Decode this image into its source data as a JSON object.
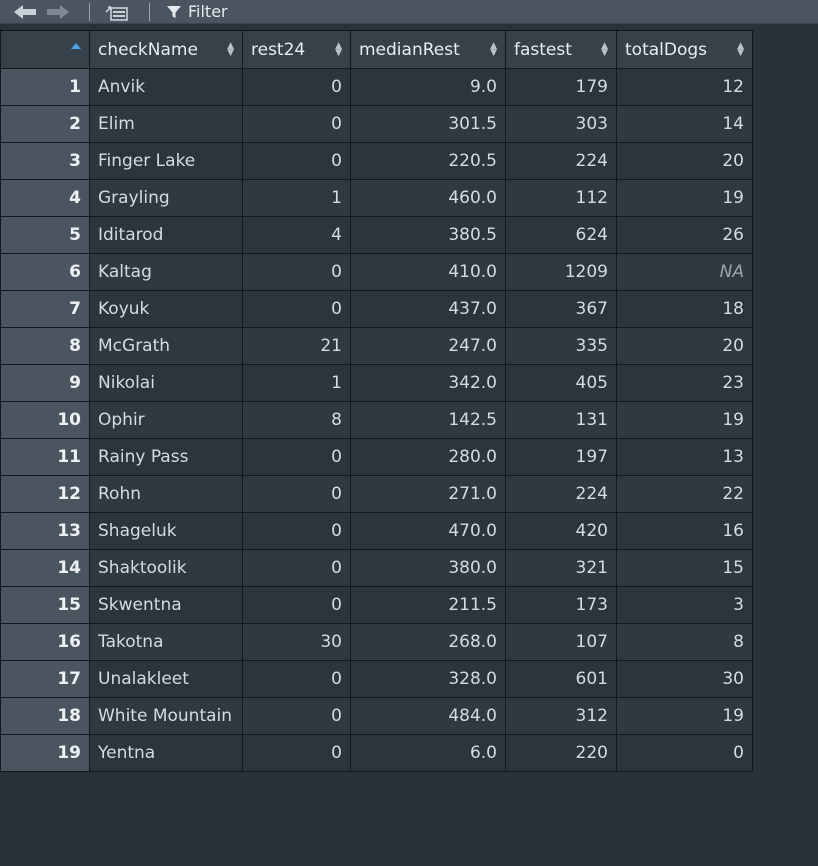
{
  "toolbar": {
    "filter_label": "Filter",
    "back_icon": "arrow-left-icon",
    "forward_icon": "arrow-right-icon",
    "popout_icon": "popout-icon",
    "filter_icon": "funnel-icon"
  },
  "table": {
    "columns": [
      "checkName",
      "rest24",
      "medianRest",
      "fastest",
      "totalDogs"
    ],
    "rows": [
      {
        "n": "1",
        "checkName": "Anvik",
        "rest24": "0",
        "medianRest": "9.0",
        "fastest": "179",
        "totalDogs": "12"
      },
      {
        "n": "2",
        "checkName": "Elim",
        "rest24": "0",
        "medianRest": "301.5",
        "fastest": "303",
        "totalDogs": "14"
      },
      {
        "n": "3",
        "checkName": "Finger Lake",
        "rest24": "0",
        "medianRest": "220.5",
        "fastest": "224",
        "totalDogs": "20"
      },
      {
        "n": "4",
        "checkName": "Grayling",
        "rest24": "1",
        "medianRest": "460.0",
        "fastest": "112",
        "totalDogs": "19"
      },
      {
        "n": "5",
        "checkName": "Iditarod",
        "rest24": "4",
        "medianRest": "380.5",
        "fastest": "624",
        "totalDogs": "26"
      },
      {
        "n": "6",
        "checkName": "Kaltag",
        "rest24": "0",
        "medianRest": "410.0",
        "fastest": "1209",
        "totalDogs": "NA"
      },
      {
        "n": "7",
        "checkName": "Koyuk",
        "rest24": "0",
        "medianRest": "437.0",
        "fastest": "367",
        "totalDogs": "18"
      },
      {
        "n": "8",
        "checkName": "McGrath",
        "rest24": "21",
        "medianRest": "247.0",
        "fastest": "335",
        "totalDogs": "20"
      },
      {
        "n": "9",
        "checkName": "Nikolai",
        "rest24": "1",
        "medianRest": "342.0",
        "fastest": "405",
        "totalDogs": "23"
      },
      {
        "n": "10",
        "checkName": "Ophir",
        "rest24": "8",
        "medianRest": "142.5",
        "fastest": "131",
        "totalDogs": "19"
      },
      {
        "n": "11",
        "checkName": "Rainy Pass",
        "rest24": "0",
        "medianRest": "280.0",
        "fastest": "197",
        "totalDogs": "13"
      },
      {
        "n": "12",
        "checkName": "Rohn",
        "rest24": "0",
        "medianRest": "271.0",
        "fastest": "224",
        "totalDogs": "22"
      },
      {
        "n": "13",
        "checkName": "Shageluk",
        "rest24": "0",
        "medianRest": "470.0",
        "fastest": "420",
        "totalDogs": "16"
      },
      {
        "n": "14",
        "checkName": "Shaktoolik",
        "rest24": "0",
        "medianRest": "380.0",
        "fastest": "321",
        "totalDogs": "15"
      },
      {
        "n": "15",
        "checkName": "Skwentna",
        "rest24": "0",
        "medianRest": "211.5",
        "fastest": "173",
        "totalDogs": "3"
      },
      {
        "n": "16",
        "checkName": "Takotna",
        "rest24": "30",
        "medianRest": "268.0",
        "fastest": "107",
        "totalDogs": "8"
      },
      {
        "n": "17",
        "checkName": "Unalakleet",
        "rest24": "0",
        "medianRest": "328.0",
        "fastest": "601",
        "totalDogs": "30"
      },
      {
        "n": "18",
        "checkName": "White Mountain",
        "rest24": "0",
        "medianRest": "484.0",
        "fastest": "312",
        "totalDogs": "19"
      },
      {
        "n": "19",
        "checkName": "Yentna",
        "rest24": "0",
        "medianRest": "6.0",
        "fastest": "220",
        "totalDogs": "0"
      }
    ]
  }
}
